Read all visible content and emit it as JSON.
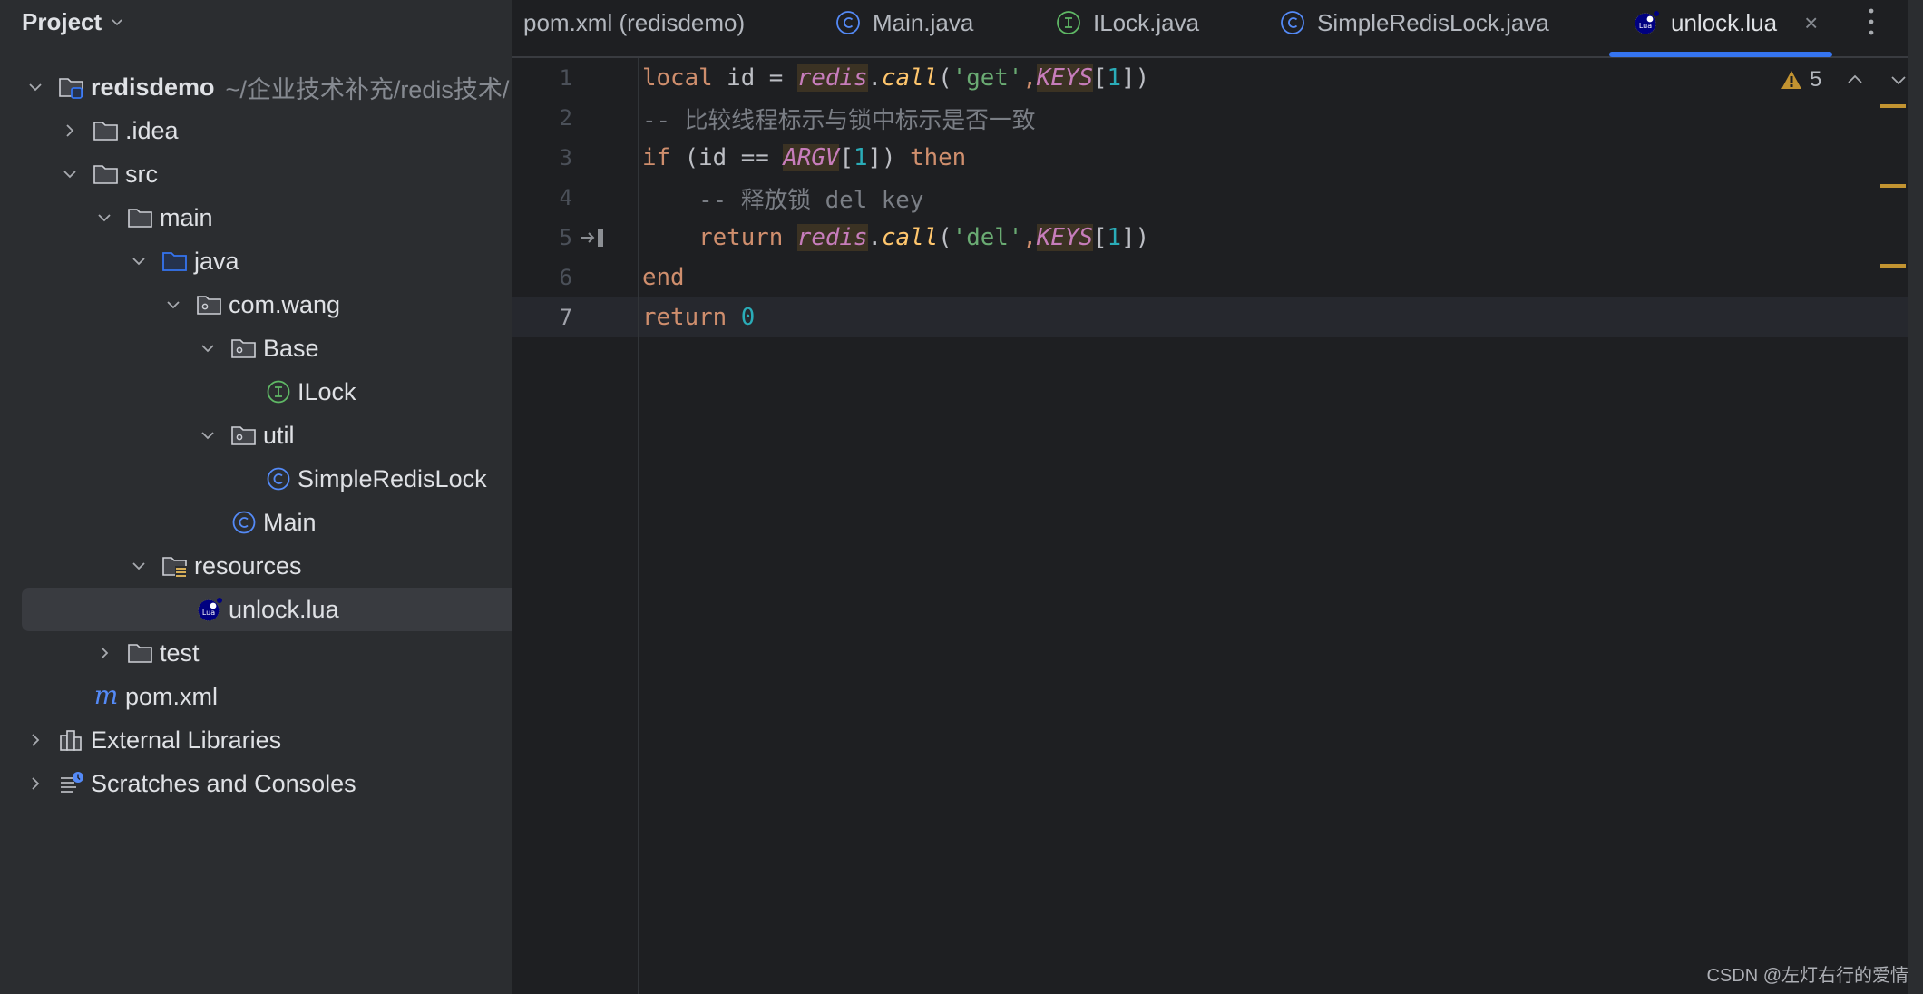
{
  "sidebar": {
    "title": "Project",
    "tree": [
      {
        "label": "redisdemo",
        "path": "~/企业技术补充/redis技术/",
        "icon": "module-folder-icon",
        "expanded": true,
        "depth": 0
      },
      {
        "label": ".idea",
        "icon": "folder-icon",
        "expanded": false,
        "depth": 1
      },
      {
        "label": "src",
        "icon": "folder-icon",
        "expanded": true,
        "depth": 1
      },
      {
        "label": "main",
        "icon": "folder-icon",
        "expanded": true,
        "depth": 2
      },
      {
        "label": "java",
        "icon": "source-folder-icon",
        "expanded": true,
        "depth": 3
      },
      {
        "label": "com.wang",
        "icon": "package-icon",
        "expanded": true,
        "depth": 4
      },
      {
        "label": "Base",
        "icon": "package-icon",
        "expanded": true,
        "depth": 5
      },
      {
        "label": "ILock",
        "icon": "interface-icon",
        "depth": 6
      },
      {
        "label": "util",
        "icon": "package-icon",
        "expanded": true,
        "depth": 5
      },
      {
        "label": "SimpleRedisLock",
        "icon": "class-icon",
        "depth": 6
      },
      {
        "label": "Main",
        "icon": "class-icon",
        "depth": 5
      },
      {
        "label": "resources",
        "icon": "resources-folder-icon",
        "expanded": true,
        "depth": 3
      },
      {
        "label": "unlock.lua",
        "icon": "lua-file-icon",
        "depth": 4,
        "selected": true
      },
      {
        "label": "test",
        "icon": "folder-icon",
        "expanded": false,
        "depth": 2
      },
      {
        "label": "pom.xml",
        "icon": "maven-icon",
        "depth": 1
      },
      {
        "label": "External Libraries",
        "icon": "libraries-icon",
        "expanded": false,
        "depth": 0
      },
      {
        "label": "Scratches and Consoles",
        "icon": "scratches-icon",
        "expanded": false,
        "depth": 0
      }
    ]
  },
  "tabs": [
    {
      "label": "pom.xml (redisdemo)",
      "icon": "maven-icon"
    },
    {
      "label": "Main.java",
      "icon": "class-icon"
    },
    {
      "label": "ILock.java",
      "icon": "interface-icon"
    },
    {
      "label": "SimpleRedisLock.java",
      "icon": "class-icon"
    },
    {
      "label": "unlock.lua",
      "icon": "lua-file-icon",
      "active": true,
      "close": "×"
    }
  ],
  "editor": {
    "language": "lua",
    "current_line": 7,
    "lines": [
      {
        "n": "1",
        "text": "local id = redis.call('get',KEYS[1])"
      },
      {
        "n": "2",
        "text": "-- 比较线程标示与锁中标示是否一致"
      },
      {
        "n": "3",
        "text": "if (id == ARGV[1]) then"
      },
      {
        "n": "4",
        "text": "    -- 释放锁 del key"
      },
      {
        "n": "5",
        "text": "    return redis.call('del',KEYS[1])"
      },
      {
        "n": "6",
        "text": "end"
      },
      {
        "n": "7",
        "text": "return 0"
      }
    ],
    "inspections": {
      "warnings": "5",
      "icon": "warning-icon"
    }
  },
  "colors": {
    "accent": "#3574f0",
    "warning": "#c29331",
    "keyword": "#cf8e6d",
    "string": "#6aab73",
    "comment": "#7a7e85",
    "global": "#c77dbb"
  },
  "watermark": "CSDN @左灯右行的爱情"
}
